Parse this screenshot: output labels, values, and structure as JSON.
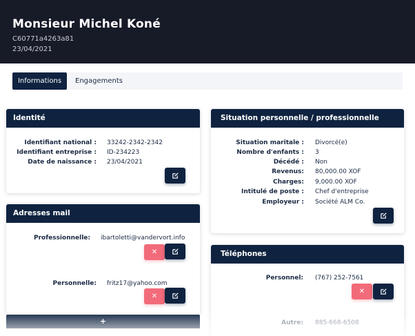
{
  "header": {
    "name": "Monsieur Michel Koné",
    "code": "C60771a4263a81",
    "date": "23/04/2021"
  },
  "tabs": [
    {
      "label": "Informations",
      "active": true
    },
    {
      "label": "Engagements",
      "active": false
    }
  ],
  "identite": {
    "title": "Identité",
    "rows": [
      {
        "label": "Identifiant national :",
        "value": "33242-2342-2342"
      },
      {
        "label": "Identifiant entreprise :",
        "value": "ID-234223"
      },
      {
        "label": "Date de naissance :",
        "value": "23/04/2021"
      }
    ]
  },
  "situation": {
    "title": "Situation personnelle / professionnelle",
    "rows": [
      {
        "label": "Situation maritale :",
        "value": "Divorcé(e)"
      },
      {
        "label": "Nombre d'enfants :",
        "value": "3"
      },
      {
        "label": "Décédé :",
        "value": "Non"
      },
      {
        "label": "Revenus:",
        "value": "80,000.00 XOF"
      },
      {
        "label": "Charges:",
        "value": "9,000.00 XOF"
      },
      {
        "label": "Intitulé de poste :",
        "value": "Chef d'entreprise"
      },
      {
        "label": "Employeur :",
        "value": "Société ALM Co."
      }
    ]
  },
  "emails": {
    "title": "Adresses mail",
    "items": [
      {
        "label": "Professionnelle:",
        "value": "ibartoletti@vandervort.info"
      },
      {
        "label": "Personnelle:",
        "value": "fritz17@yahoo.com"
      }
    ],
    "add_label": "+"
  },
  "phones": {
    "title": "Téléphones",
    "items": [
      {
        "label": "Personnel:",
        "value": "(767) 252-7561"
      },
      {
        "label": "Autre:",
        "value": "885-668-6508"
      }
    ]
  },
  "icons": {
    "edit": "edit-icon",
    "delete": "close-icon"
  },
  "colors": {
    "header_bg": "#171a27",
    "navy": "#0f2340",
    "delete_red": "#f26b7a"
  }
}
